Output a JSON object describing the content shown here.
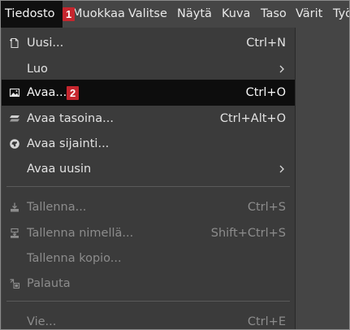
{
  "menubar": {
    "items": [
      {
        "label": "Tiedosto"
      },
      {
        "label": "Muokkaa"
      },
      {
        "label": "Valitse"
      },
      {
        "label": "Näytä"
      },
      {
        "label": "Kuva"
      },
      {
        "label": "Taso"
      },
      {
        "label": "Värit"
      },
      {
        "label": "Työ"
      }
    ]
  },
  "badges": {
    "first": "1",
    "second": "2",
    "color": "#c6262e"
  },
  "menu": {
    "items": [
      {
        "label": "Uusi...",
        "accel": "Ctrl+N",
        "icon": "new-image-icon",
        "enabled": true
      },
      {
        "label": "Luo",
        "accel": "",
        "icon": "",
        "submenu": true,
        "enabled": true
      },
      {
        "label": "Avaa...",
        "accel": "Ctrl+O",
        "icon": "open-image-icon",
        "enabled": true,
        "highlighted": true
      },
      {
        "label": "Avaa tasoina...",
        "accel": "Ctrl+Alt+O",
        "icon": "open-as-layers-icon",
        "enabled": true
      },
      {
        "label": "Avaa sijainti...",
        "accel": "",
        "icon": "location-icon",
        "enabled": true
      },
      {
        "label": "Avaa uusin",
        "accel": "",
        "icon": "",
        "submenu": true,
        "enabled": true
      },
      {
        "label": "Tallenna...",
        "accel": "Ctrl+S",
        "icon": "save-icon",
        "enabled": false
      },
      {
        "label": "Tallenna nimellä...",
        "accel": "Shift+Ctrl+S",
        "icon": "save-as-icon",
        "enabled": false
      },
      {
        "label": "Tallenna kopio...",
        "accel": "",
        "icon": "",
        "enabled": false
      },
      {
        "label": "Palauta",
        "accel": "",
        "icon": "revert-icon",
        "enabled": false
      },
      {
        "label": "Vie...",
        "accel": "Ctrl+E",
        "icon": "",
        "enabled": false
      }
    ]
  },
  "colors": {
    "menubar_bg": "#454545",
    "menu_bg": "#3b3b3b",
    "highlight_bg": "#0d0d0d",
    "text": "#e2e2e2",
    "disabled_text": "#8c8c8c"
  }
}
